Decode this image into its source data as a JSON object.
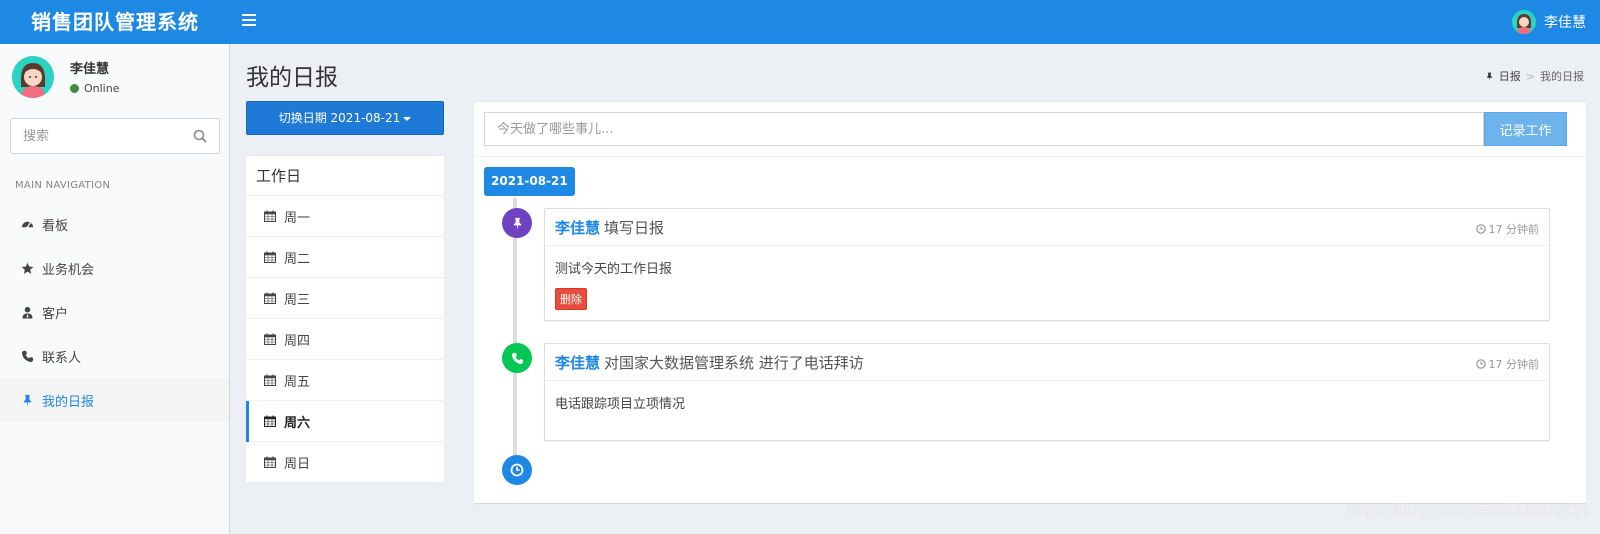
{
  "header": {
    "app_title": "销售团队管理系统",
    "user_name": "李佳慧",
    "brand_color": "#1e88e5"
  },
  "sidebar": {
    "user": {
      "name": "李佳慧",
      "status": "Online"
    },
    "search": {
      "placeholder": "搜索",
      "value": ""
    },
    "nav_header": "MAIN NAVIGATION",
    "items": [
      {
        "label": "看板",
        "icon": "dashboard-icon"
      },
      {
        "label": "业务机会",
        "icon": "star-icon"
      },
      {
        "label": "客户",
        "icon": "user-tie-icon"
      },
      {
        "label": "联系人",
        "icon": "phone-icon"
      },
      {
        "label": "我的日报",
        "icon": "pin-icon",
        "active": true
      }
    ]
  },
  "page": {
    "title": "我的日报",
    "breadcrumb": [
      "日报",
      "我的日报"
    ]
  },
  "date_switch": {
    "label": "切换日期 2021-08-21"
  },
  "workdays": {
    "title": "工作日",
    "days": [
      {
        "label": "周一"
      },
      {
        "label": "周二"
      },
      {
        "label": "周三"
      },
      {
        "label": "周四"
      },
      {
        "label": "周五"
      },
      {
        "label": "周六",
        "active": true
      },
      {
        "label": "周日"
      }
    ]
  },
  "entry": {
    "placeholder": "今天做了哪些事儿...",
    "value": "",
    "submit_label": "记录工作"
  },
  "timeline": {
    "date": "2021-08-21",
    "items": [
      {
        "user": "李佳慧",
        "action": "填写日报",
        "time": "17 分钟前",
        "body": "测试今天的工作日报",
        "delete_label": "删除",
        "icon": "pin-icon",
        "icon_color": "#6f42c1"
      },
      {
        "user": "李佳慧",
        "action": "对国家大数据管理系统 进行了电话拜访",
        "time": "17 分钟前",
        "body": "电话跟踪项目立项情况",
        "icon": "phone-icon",
        "icon_color": "#00c853"
      }
    ],
    "end_icon": "clock-icon"
  },
  "watermark": "https://blog.csdn.net/whirlwind526"
}
